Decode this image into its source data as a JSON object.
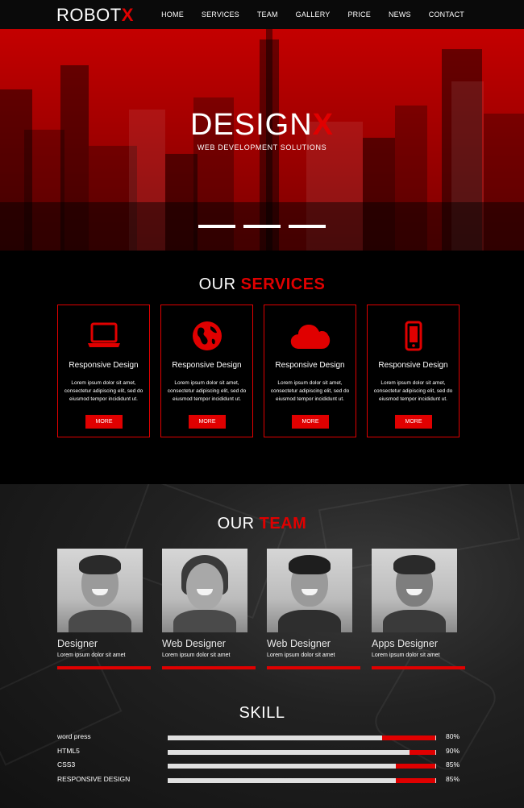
{
  "brand": {
    "name": "ROBOT",
    "accent": "X"
  },
  "nav": {
    "items": [
      "HOME",
      "SERVICES",
      "TEAM",
      "GALLERY",
      "PRICE",
      "NEWS",
      "CONTACT"
    ]
  },
  "hero": {
    "title": "DESIGN",
    "title_accent": "X",
    "subtitle": "WEB DEVELOPMENT SOLUTIONS",
    "slides": 3
  },
  "services": {
    "title": "OUR",
    "title_accent": "SERVICES",
    "cards": [
      {
        "icon": "laptop-icon",
        "title": "Responsive Design",
        "desc": "Lorem ipsum dolor sit amet, consectetur adipiscing elit, sed do eiusmod tempor incididunt ut.",
        "button": "MORE"
      },
      {
        "icon": "globe-icon",
        "title": "Responsive Design",
        "desc": "Lorem ipsum dolor sit amet, consectetur adipiscing elit, sed do eiusmod tempor incididunt ut.",
        "button": "MORE"
      },
      {
        "icon": "cloud-icon",
        "title": "Responsive Design",
        "desc": "Lorem ipsum dolor sit amet, consectetur adipiscing elit, sed do eiusmod tempor incididunt ut.",
        "button": "MORE"
      },
      {
        "icon": "mobile-icon",
        "title": "Responsive Design",
        "desc": "Lorem ipsum dolor sit amet, consectetur adipiscing elit, sed do eiusmod tempor incididunt ut.",
        "button": "MORE"
      }
    ]
  },
  "team": {
    "title": "OUR",
    "title_accent": "TEAM",
    "members": [
      {
        "role": "Designer",
        "desc": "Lorem ipsum dolor sit amet"
      },
      {
        "role": "Web Designer",
        "desc": "Lorem ipsum dolor sit amet"
      },
      {
        "role": "Web Designer",
        "desc": "Lorem ipsum dolor sit amet"
      },
      {
        "role": "Apps Designer",
        "desc": "Lorem ipsum dolor sit amet"
      }
    ]
  },
  "skill": {
    "title": "SKILL",
    "items": [
      {
        "label": "word press",
        "percent": "80%",
        "value": 0.8
      },
      {
        "label": "HTML5",
        "percent": "90%",
        "value": 0.9
      },
      {
        "label": "CSS3",
        "percent": "85%",
        "value": 0.85
      },
      {
        "label": "RESPONSIVE DESIGN",
        "percent": "85%",
        "value": 0.85
      }
    ]
  },
  "colors": {
    "accent": "#e00000",
    "background": "#000000"
  }
}
